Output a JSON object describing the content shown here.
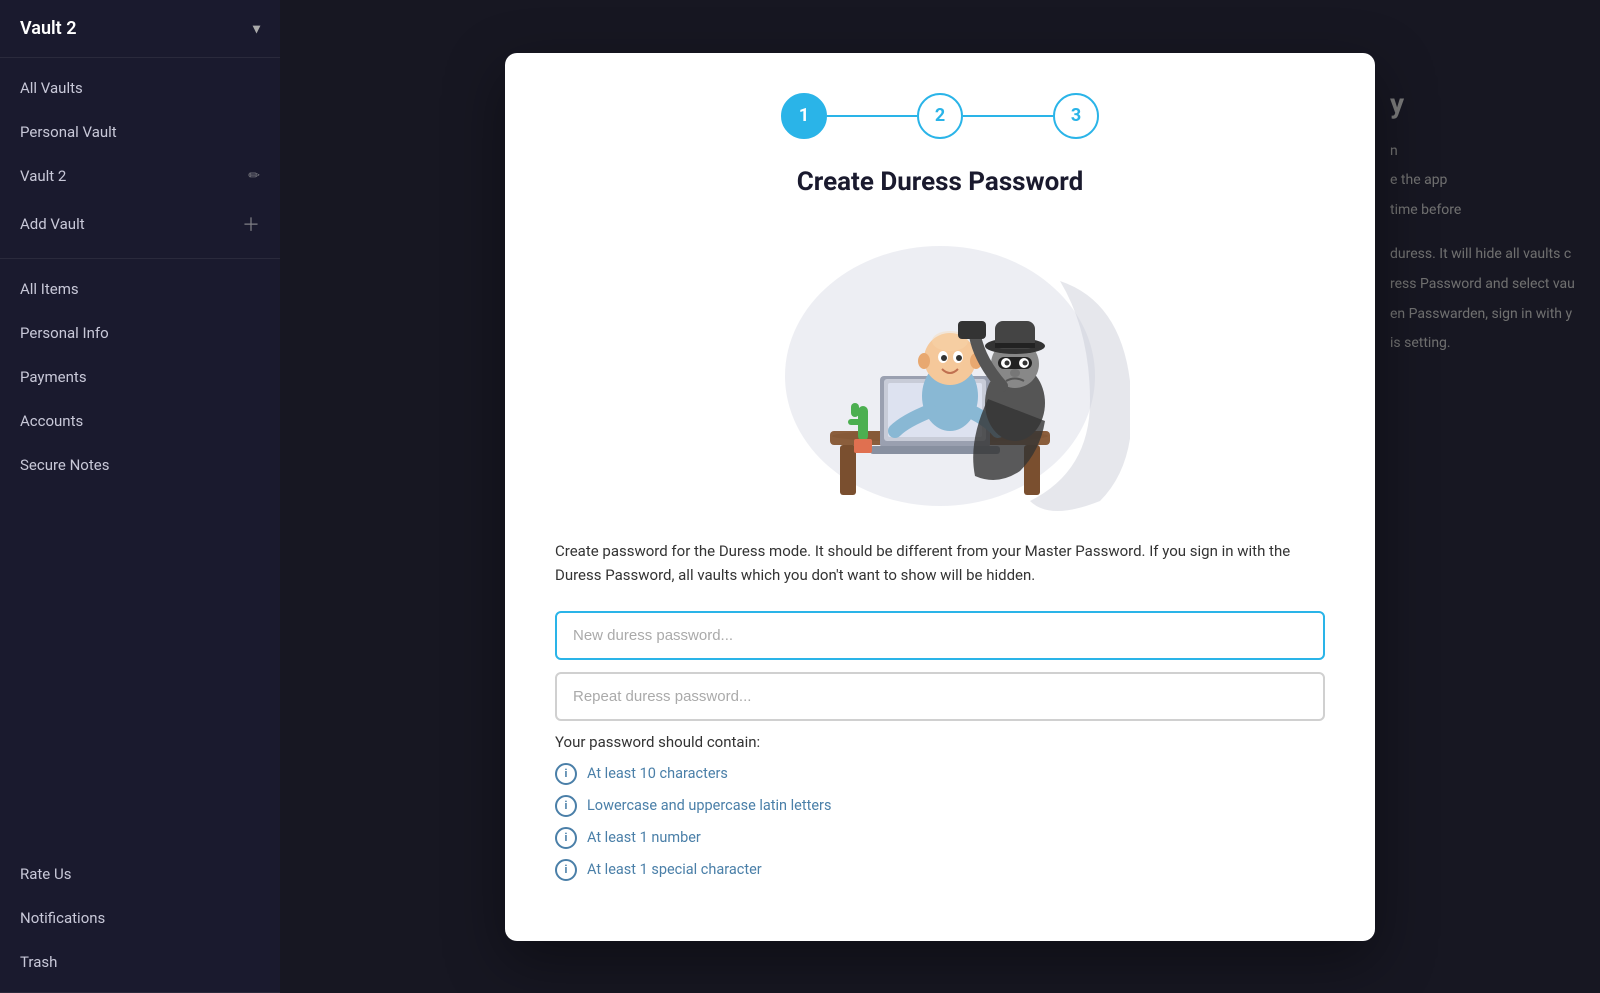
{
  "sidebar": {
    "vault_name": "Vault 2",
    "items": [
      {
        "id": "all-vaults",
        "label": "All Vaults",
        "icon": "vault-icon",
        "active": false
      },
      {
        "id": "personal-vault",
        "label": "Personal Vault",
        "icon": "vault-icon",
        "active": false
      },
      {
        "id": "vault2",
        "label": "Vault 2",
        "icon": "vault-icon",
        "active": false,
        "editable": true
      }
    ],
    "add_vault_label": "Add Vault",
    "categories": [
      {
        "id": "all-items",
        "label": "All Items"
      },
      {
        "id": "personal-info",
        "label": "Personal Info"
      },
      {
        "id": "payments",
        "label": "Payments"
      },
      {
        "id": "accounts",
        "label": "Accounts"
      },
      {
        "id": "secure-notes",
        "label": "Secure Notes"
      }
    ],
    "bottom_items": [
      {
        "id": "rate-us",
        "label": "Rate Us"
      },
      {
        "id": "notifications",
        "label": "Notifications"
      },
      {
        "id": "trash",
        "label": "Trash"
      }
    ]
  },
  "modal": {
    "title": "Create Duress Password",
    "steps": [
      {
        "number": "1",
        "active": true
      },
      {
        "number": "2",
        "active": false
      },
      {
        "number": "3",
        "active": false
      }
    ],
    "description": "Create password for the Duress mode. It should be different from your Master Password. If you sign in with the Duress Password, all vaults which you don't want to show will be hidden.",
    "new_password_placeholder": "New duress password...",
    "repeat_password_placeholder": "Repeat duress password...",
    "requirements_title": "Your password should contain:",
    "requirements": [
      {
        "id": "min-chars",
        "text": "At least 10 characters"
      },
      {
        "id": "case-letters",
        "text": "Lowercase and uppercase latin letters"
      },
      {
        "id": "number",
        "text": "At least 1 number"
      },
      {
        "id": "special-char",
        "text": "At least 1 special character"
      }
    ]
  },
  "background_text": {
    "partial_title": "y",
    "line1": "n",
    "line2": "e the app",
    "line3": "time before",
    "duress_description": "duress. It will hide all vaults c",
    "line5": "ress Password and select vau",
    "line6": "en Passwarden, sign in with y",
    "line7": "is setting."
  },
  "colors": {
    "accent_blue": "#2ab4e8",
    "sidebar_bg": "#1a1a2e",
    "sidebar_text": "#c8c8d8",
    "modal_bg": "#ffffff",
    "text_dark": "#1a1a2e",
    "text_muted": "#aaaaaa",
    "req_color": "#4a7fa8"
  }
}
